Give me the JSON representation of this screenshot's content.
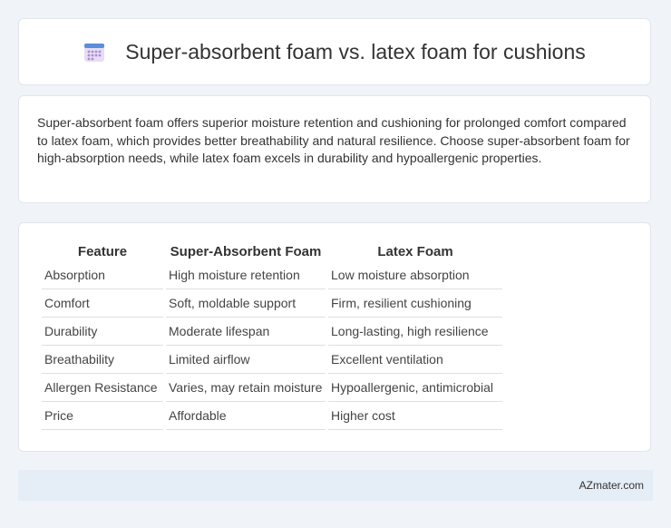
{
  "header": {
    "title": "Super-absorbent foam vs. latex foam for cushions",
    "icon": "calendar-icon"
  },
  "summary": {
    "text": "Super-absorbent foam offers superior moisture retention and cushioning for prolonged comfort compared to latex foam, which provides better breathability and natural resilience. Choose super-absorbent foam for high-absorption needs, while latex foam excels in durability and hypoallergenic properties."
  },
  "table": {
    "headers": [
      "Feature",
      "Super-Absorbent Foam",
      "Latex Foam"
    ],
    "rows": [
      [
        "Absorption",
        "High moisture retention",
        "Low moisture absorption"
      ],
      [
        "Comfort",
        "Soft, moldable support",
        "Firm, resilient cushioning"
      ],
      [
        "Durability",
        "Moderate lifespan",
        "Long-lasting, high resilience"
      ],
      [
        "Breathability",
        "Limited airflow",
        "Excellent ventilation"
      ],
      [
        "Allergen Resistance",
        "Varies, may retain moisture",
        "Hypoallergenic, antimicrobial"
      ],
      [
        "Price",
        "Affordable",
        "Higher cost"
      ]
    ]
  },
  "footer": {
    "brand": "AZmater.com"
  },
  "colors": {
    "background": "#f0f4f8",
    "card": "#ffffff",
    "footer": "#e5edf7",
    "icon_top": "#5b8dd8",
    "icon_body": "#d9c6ee"
  }
}
